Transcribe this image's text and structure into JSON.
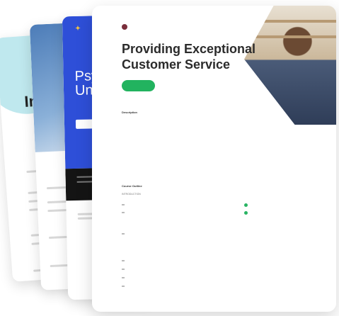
{
  "back_cards": {
    "card1": {
      "title_fragment": "In"
    },
    "card2": {},
    "card3": {
      "title_lines": [
        "Psy",
        "Unlo"
      ]
    }
  },
  "front": {
    "logo_text": "",
    "title_line1": "Providing Exceptional",
    "title_line2": "Customer Service",
    "cta_label": "",
    "description_heading": "Description",
    "paragraph1": "",
    "paragraph2": "",
    "outline_heading": "Course Outline",
    "intro_label": "INTRODUCTION",
    "intro_items": [
      {
        "label": "",
        "done": true
      },
      {
        "label": "",
        "done": true
      },
      {
        "label": "",
        "done": false
      }
    ],
    "section2_label": "",
    "section2_items": [
      "",
      "",
      "",
      ""
    ],
    "colors": {
      "accent": "#22b35f",
      "blue": "#2e4fd8",
      "title": "#2b2b2b"
    }
  }
}
